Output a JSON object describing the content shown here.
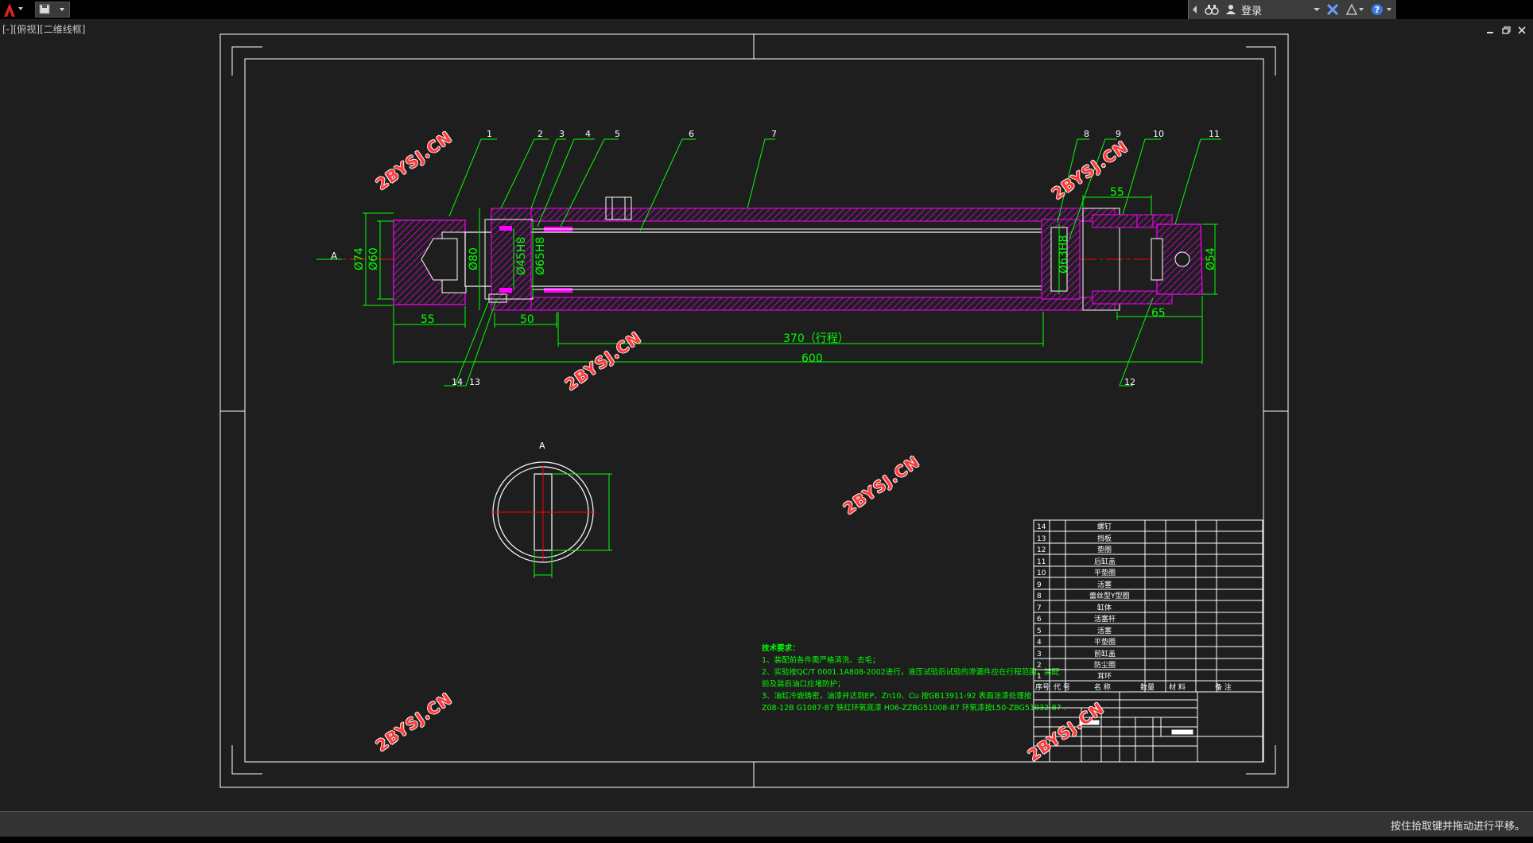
{
  "titlebar": {
    "login_label": "登录"
  },
  "viewport_label": "[-][俯视][二维线框]",
  "status": {
    "hint": "按住拾取键并拖动进行平移。"
  },
  "watermark": "2BYSJ.CN",
  "drawing": {
    "section_marker": "A",
    "view_label": "A",
    "part_callouts": [
      "1",
      "2",
      "3",
      "4",
      "5",
      "6",
      "7",
      "8",
      "9",
      "10",
      "11",
      "12",
      "13",
      "14"
    ],
    "dimensions": {
      "d74": "Ø74",
      "d60": "Ø60",
      "d80": "Ø80",
      "d45": "Ø45H8",
      "d65": "Ø65H8",
      "d63": "Ø63H8",
      "d54": "Ø54",
      "len55_left": "55",
      "len50": "50",
      "stroke": "370（行程）",
      "total": "600",
      "len55_right": "55",
      "len65": "65"
    },
    "tech_req": {
      "title": "技术要求：",
      "lines": [
        "1、装配前各件需严格清洗、去毛；",
        "2、实验按QC/T 0001.1A808-2002进行，液压试验后试验的渗漏件应在行程范围，装配",
        "前及装后油口应堵防护；",
        "3、油缸冷嵌铸密，油漆并达到EP、Zn10、Cu 按GB13911-92 表面涂漆处理按",
        "Z08-12B G1087-87 铁红环氧底漆 H06-ZZBG51008-87 环氧漆按L50-ZBG51032-87 ."
      ]
    },
    "bom": {
      "rows": [
        {
          "no": "14",
          "name": "螺钉"
        },
        {
          "no": "13",
          "name": "挡板"
        },
        {
          "no": "12",
          "name": "垫圈"
        },
        {
          "no": "11",
          "name": "后缸盖"
        },
        {
          "no": "10",
          "name": "平垫圈"
        },
        {
          "no": "9",
          "name": "活塞"
        },
        {
          "no": "8",
          "name": "蕾丝型Y型圈"
        },
        {
          "no": "7",
          "name": "缸体"
        },
        {
          "no": "6",
          "name": "活塞杆"
        },
        {
          "no": "5",
          "name": "活塞"
        },
        {
          "no": "4",
          "name": "平垫圈"
        },
        {
          "no": "3",
          "name": "前缸盖"
        },
        {
          "no": "2",
          "name": "防尘圈"
        },
        {
          "no": "1",
          "name": "耳环"
        }
      ],
      "header": {
        "no": "序号",
        "code": "代 号",
        "name": "名 称",
        "qty": "数量",
        "material": "材 料",
        "remark": "备 注"
      }
    }
  },
  "colors": {
    "green": "#00ff00",
    "magenta": "#ff00ff",
    "white": "#ffffff",
    "red": "#ff0000",
    "background": "#1e1e1e"
  }
}
